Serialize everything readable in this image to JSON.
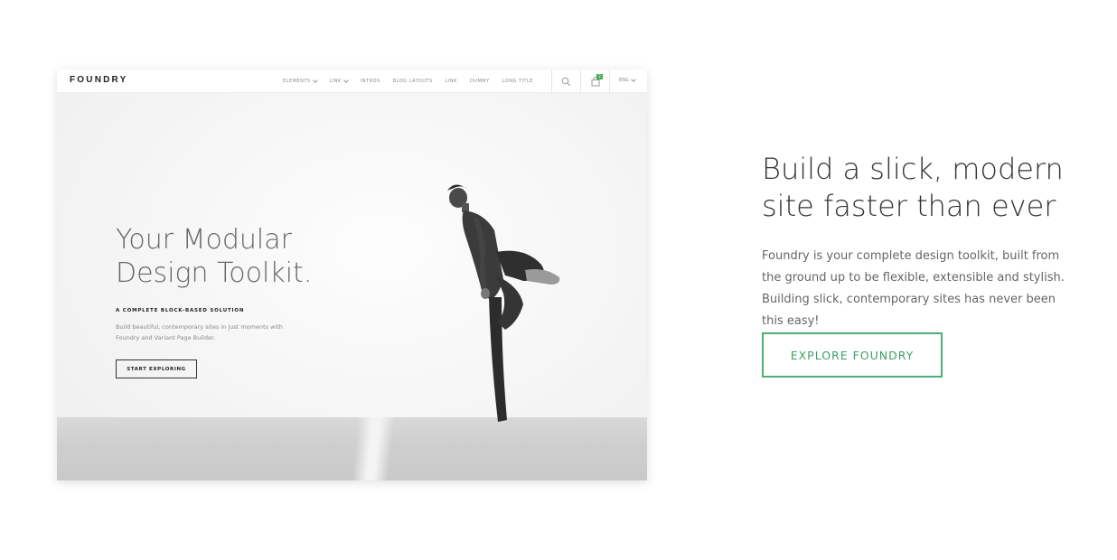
{
  "mockup": {
    "nav": {
      "logo": "FOUNDRY",
      "items": [
        {
          "label": "ELEMENTS",
          "dropdown": true
        },
        {
          "label": "LINK",
          "dropdown": true
        },
        {
          "label": "INTROS",
          "dropdown": false
        },
        {
          "label": "BLOG LAYOUTS",
          "dropdown": false
        },
        {
          "label": "LINK",
          "dropdown": false
        },
        {
          "label": "DUMMY",
          "dropdown": false
        },
        {
          "label": "LONG TITLE",
          "dropdown": false
        }
      ],
      "search_icon": "search-icon",
      "cart_icon": "shopping-bag-icon",
      "cart_count": "2",
      "language": "ENG"
    },
    "hero": {
      "heading": "Your Modular Design Toolkit.",
      "eyebrow": "A COMPLETE BLOCK-BASED SOLUTION",
      "body": "Build beautiful, contemporary sites in just moments with Foundry and Variant Page Builder.",
      "button": "START EXPLORING"
    }
  },
  "promo": {
    "headline": "Build a slick, modern site faster than ever",
    "description": "Foundry is your complete design toolkit, built from the ground up to be flexible, extensible and stylish. Building slick, contemporary sites has never been this easy!",
    "cta": "EXPLORE FOUNDRY",
    "accent_color": "#4caf7a"
  }
}
